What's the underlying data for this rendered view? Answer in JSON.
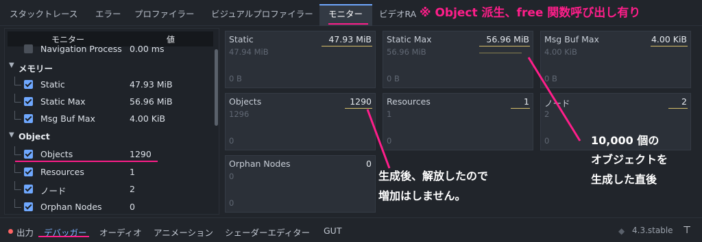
{
  "tabs": [
    "スタックトレース",
    "エラー",
    "プロファイラー",
    "ビジュアルプロファイラー",
    "モニター",
    "ビデオRA"
  ],
  "active_tab": "モニター",
  "tree": {
    "col_monitor": "モニター",
    "col_value": "値",
    "rows": [
      {
        "type": "item",
        "label": "Navigation Process",
        "value": "0.00 ms",
        "checked": false
      },
      {
        "type": "category",
        "label": "メモリー"
      },
      {
        "type": "item",
        "label": "Static",
        "value": "47.93 MiB",
        "checked": true
      },
      {
        "type": "item",
        "label": "Static Max",
        "value": "56.96 MiB",
        "checked": true
      },
      {
        "type": "item",
        "label": "Msg Buf Max",
        "value": "4.00 KiB",
        "checked": true
      },
      {
        "type": "category",
        "label": "Object"
      },
      {
        "type": "item",
        "label": "Objects",
        "value": "1290",
        "checked": true
      },
      {
        "type": "item",
        "label": "Resources",
        "value": "1",
        "checked": true
      },
      {
        "type": "item",
        "label": "ノード",
        "value": "2",
        "checked": true
      },
      {
        "type": "item",
        "label": "Orphan Nodes",
        "value": "0",
        "checked": true
      }
    ]
  },
  "graphs": [
    {
      "title": "Static",
      "value": "47.93 MiB",
      "max": "47.94 MiB",
      "zero": "0 B"
    },
    {
      "title": "Static Max",
      "value": "56.96 MiB",
      "max": "56.96 MiB",
      "zero": "0 B"
    },
    {
      "title": "Msg Buf Max",
      "value": "4.00 KiB",
      "max": "4.00 KiB",
      "zero": "0 B"
    },
    {
      "title": "Objects",
      "value": "1290",
      "max": "1296",
      "zero": "0"
    },
    {
      "title": "Resources",
      "value": "1",
      "max": "1",
      "zero": "0"
    },
    {
      "title": "ノード",
      "value": "2",
      "max": "2",
      "zero": "0"
    },
    {
      "title": "Orphan Nodes",
      "value": "0",
      "max": "0",
      "zero": "0"
    }
  ],
  "bottom_tabs": [
    "出力",
    "デバッガー",
    "オーディオ",
    "アニメーション",
    "シェーダーエディター",
    "GUT"
  ],
  "active_bottom_tab": "デバッガー",
  "version": "4.3.stable",
  "annotations": {
    "top": "※ Object 派生、free 関数呼び出し有り",
    "right": [
      "10,000 個の",
      "オブジェクトを",
      "生成した直後"
    ],
    "middle": [
      "生成後、解放したので",
      "増加はしません。"
    ]
  },
  "colors": {
    "accent": "#6fa8ff",
    "annotation": "#ff1e8a"
  }
}
